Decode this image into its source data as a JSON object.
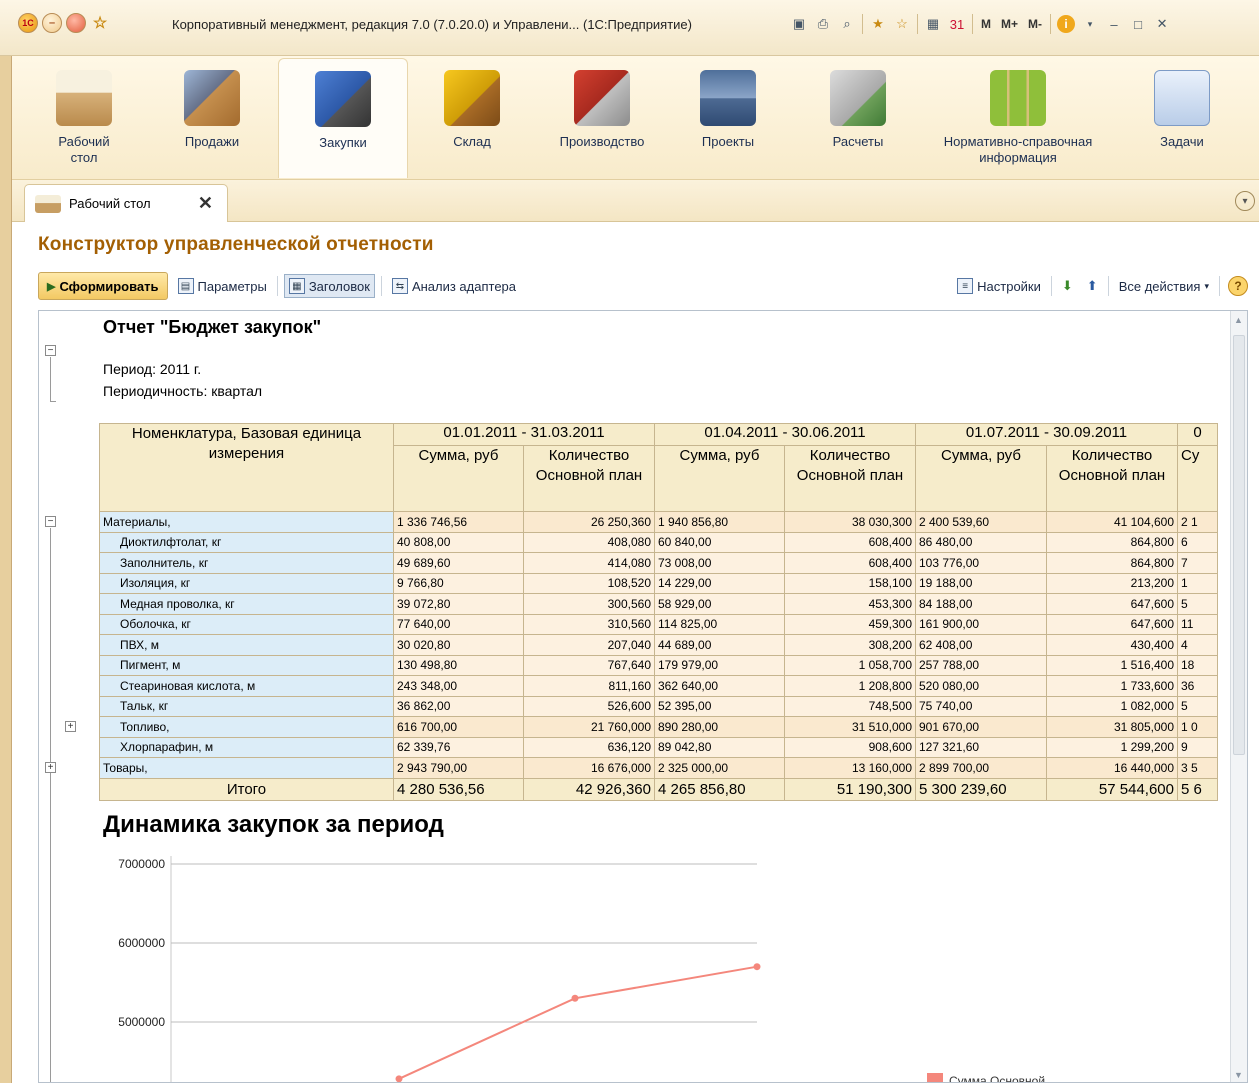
{
  "window": {
    "title": "Корпоративный менеджмент, редакция 7.0 (7.0.20.0) и Управлени... (1С:Предприятие)",
    "m_labels": [
      "M",
      "M+",
      "M-"
    ]
  },
  "sections": [
    {
      "label": "Рабочий стол",
      "active": false
    },
    {
      "label": "Продажи",
      "active": false
    },
    {
      "label": "Закупки",
      "active": true
    },
    {
      "label": "Склад",
      "active": false
    },
    {
      "label": "Производство",
      "active": false
    },
    {
      "label": "Проекты",
      "active": false
    },
    {
      "label": "Расчеты",
      "active": false
    },
    {
      "label": "Нормативно-справочная информация",
      "active": false
    },
    {
      "label": "Задачи",
      "active": false
    }
  ],
  "tab": {
    "label": "Рабочий стол"
  },
  "form": {
    "title": "Конструктор управленческой отчетности",
    "commands": {
      "run": "Сформировать",
      "params": "Параметры",
      "header": "Заголовок",
      "adapter": "Анализ адаптера",
      "settings": "Настройки",
      "all_actions": "Все действия"
    }
  },
  "report": {
    "title": "Отчет \"Бюджет закупок\"",
    "period": "Период: 2011 г.",
    "periodicity": "Периодичность: квартал",
    "header": {
      "name_col": "Номенклатура, Базовая единица измерения",
      "periods": [
        "01.01.2011 - 31.03.2011",
        "01.04.2011 - 30.06.2011",
        "01.07.2011 - 30.09.2011",
        "0"
      ],
      "sum": "Сумма, руб",
      "qty": "Количество Основной план",
      "sum_cut": "Су"
    },
    "rows": [
      {
        "name": "Материалы,",
        "level": 0,
        "values": [
          "1 336 746,56",
          "26 250,360",
          "1 940 856,80",
          "38 030,300",
          "2 400 539,60",
          "41 104,600",
          "2 1"
        ]
      },
      {
        "name": "Диоктилфтолат, кг",
        "level": 1,
        "values": [
          "40 808,00",
          "408,080",
          "60 840,00",
          "608,400",
          "86 480,00",
          "864,800",
          "6"
        ]
      },
      {
        "name": "Заполнитель, кг",
        "level": 1,
        "values": [
          "49 689,60",
          "414,080",
          "73 008,00",
          "608,400",
          "103 776,00",
          "864,800",
          "7"
        ]
      },
      {
        "name": "Изоляция, кг",
        "level": 1,
        "values": [
          "9 766,80",
          "108,520",
          "14 229,00",
          "158,100",
          "19 188,00",
          "213,200",
          "1"
        ]
      },
      {
        "name": "Медная проволка, кг",
        "level": 1,
        "values": [
          "39 072,80",
          "300,560",
          "58 929,00",
          "453,300",
          "84 188,00",
          "647,600",
          "5"
        ]
      },
      {
        "name": "Оболочка, кг",
        "level": 1,
        "values": [
          "77 640,00",
          "310,560",
          "114 825,00",
          "459,300",
          "161 900,00",
          "647,600",
          "11"
        ]
      },
      {
        "name": "ПВХ, м",
        "level": 1,
        "values": [
          "30 020,80",
          "207,040",
          "44 689,00",
          "308,200",
          "62 408,00",
          "430,400",
          "4"
        ]
      },
      {
        "name": "Пигмент, м",
        "level": 1,
        "values": [
          "130 498,80",
          "767,640",
          "179 979,00",
          "1 058,700",
          "257 788,00",
          "1 516,400",
          "18"
        ]
      },
      {
        "name": "Стеариновая кислота, м",
        "level": 1,
        "values": [
          "243 348,00",
          "811,160",
          "362 640,00",
          "1 208,800",
          "520 080,00",
          "1 733,600",
          "36"
        ]
      },
      {
        "name": "Тальк, кг",
        "level": 1,
        "values": [
          "36 862,00",
          "526,600",
          "52 395,00",
          "748,500",
          "75 740,00",
          "1 082,000",
          "5"
        ]
      },
      {
        "name": "Топливо,",
        "level": 1,
        "group": true,
        "values": [
          "616 700,00",
          "21 760,000",
          "890 280,00",
          "31 510,000",
          "901 670,00",
          "31 805,000",
          "1 0"
        ]
      },
      {
        "name": "Хлорпарафин, м",
        "level": 1,
        "values": [
          "62 339,76",
          "636,120",
          "89 042,80",
          "908,600",
          "127 321,60",
          "1 299,200",
          "9"
        ]
      },
      {
        "name": "Товары,",
        "level": 0,
        "group": true,
        "values": [
          "2 943 790,00",
          "16 676,000",
          "2 325 000,00",
          "13 160,000",
          "2 899 700,00",
          "16 440,000",
          "3 5"
        ]
      }
    ],
    "total": {
      "label": "Итого",
      "values": [
        "4 280 536,56",
        "42 926,360",
        "4 265 856,80",
        "51 190,300",
        "5 300 239,60",
        "57 544,600",
        "5 6"
      ]
    }
  },
  "chart_data": {
    "type": "line",
    "title": "Динамика закупок за период",
    "y_ticks": [
      5000000,
      6000000,
      7000000
    ],
    "series": [
      {
        "name": "Сумма Основной план",
        "color": "#f4877c",
        "x": [
          1,
          2,
          3
        ],
        "values": [
          4280536.56,
          5300239.6,
          5700000
        ]
      }
    ],
    "visible_y_range": [
      4600000,
      7000000
    ],
    "legend": "right"
  }
}
